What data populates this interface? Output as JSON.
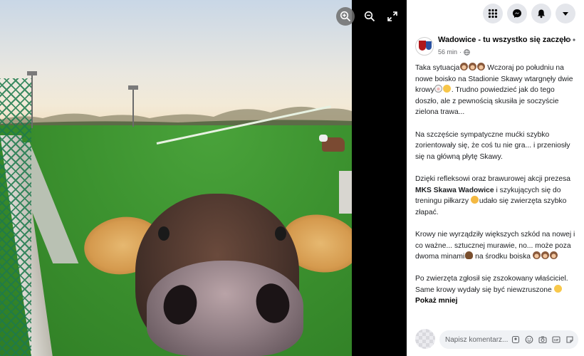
{
  "post": {
    "page_name": "Wadowice - tu wszystko się zaczęło",
    "time": "56 min",
    "paragraphs": {
      "p1a": "Taka sytuacja",
      "p1b": " Wczoraj po południu na nowe boisko na Stadionie Skawy wtargnęły dwie krowy",
      "p1c": ". Trudno powiedzieć jak do tego doszło, ale z pewnością skusiła je soczyście zielona trawa...",
      "p2": "Na szczęście sympatyczne mućki szybko zorientowały się, że coś tu nie gra... i przeniosły się na główną płytę Skawy.",
      "p3a": "Dzięki refleksowi oraz brawurowej akcji prezesa ",
      "p3b": "MKS Skawa Wadowice",
      "p3c": " i szykujących się do treningu piłkarzy ",
      "p3d": "udało się zwierzęta szybko złapać.",
      "p4a": "Krowy nie wyrządziły większych szkód na nowej i co ważne... sztucznej murawie, no... może poza dwoma minami",
      "p4b": " na środku boiska ",
      "p5": "Po zwierzęta zgłosił się zszokowany właściciel. Same krowy wydały się być niewzruszone "
    },
    "show_less": "Pokaż mniej"
  },
  "comment": {
    "placeholder": "Napisz komentarz..."
  },
  "icons": {
    "zoom_in": "zoom-in-icon",
    "zoom_out": "zoom-out-icon",
    "fullscreen": "fullscreen-icon",
    "menu": "grid-menu-icon",
    "messenger": "messenger-icon",
    "notifications": "bell-icon",
    "account": "caret-down-icon",
    "globe": "globe-icon",
    "more": "more-dots-icon"
  },
  "colors": {
    "panel_bg": "#ffffff",
    "viewer_bg": "#000000",
    "text_primary": "#050505",
    "text_secondary": "#65676b",
    "chip_bg": "#e4e6eb"
  }
}
